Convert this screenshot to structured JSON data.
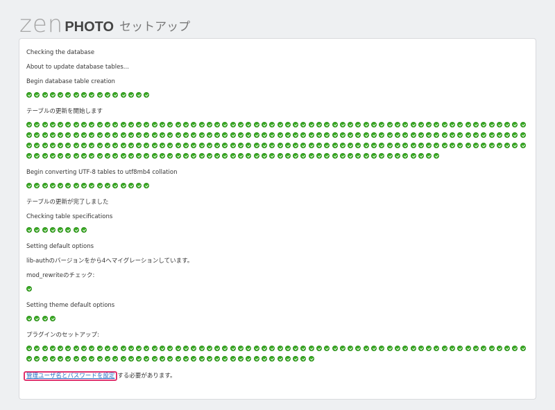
{
  "header": {
    "logo_zen": "ZEN",
    "logo_photo": "PHOTO",
    "subtitle": "セットアップ"
  },
  "log": {
    "checking_database": "Checking the database",
    "about_to_update": "About to update database tables...",
    "begin_creation": "Begin database table creation",
    "creation_checks": 16,
    "updating_tables": "テーブルの更新を開始します",
    "update_checks": 245,
    "begin_converting": "Begin converting UTF-8 tables to utf8mb4 collation",
    "convert_checks": 16,
    "update_complete": "テーブルの更新が完了しました",
    "checking_specs": "Checking table specifications",
    "spec_checks": 8,
    "setting_defaults": "Setting default options",
    "lib_auth_migration": "lib-authのバージョンをから4へマイグレーションしています。",
    "mod_rewrite_check": "mod_rewriteのチェック:",
    "mod_rewrite_checks": 1,
    "theme_defaults": "Setting theme default options",
    "theme_checks": 4,
    "plugin_setup": "プラグインのセットアップ:",
    "plugin_checks": 101
  },
  "final": {
    "link_text": "管理ユーザ名とパスワードを設定",
    "rest_text": "する必要があります。"
  },
  "colors": {
    "check_green": "#3aab24",
    "link_blue": "#2a6ec4",
    "highlight_border": "#e0306c"
  }
}
